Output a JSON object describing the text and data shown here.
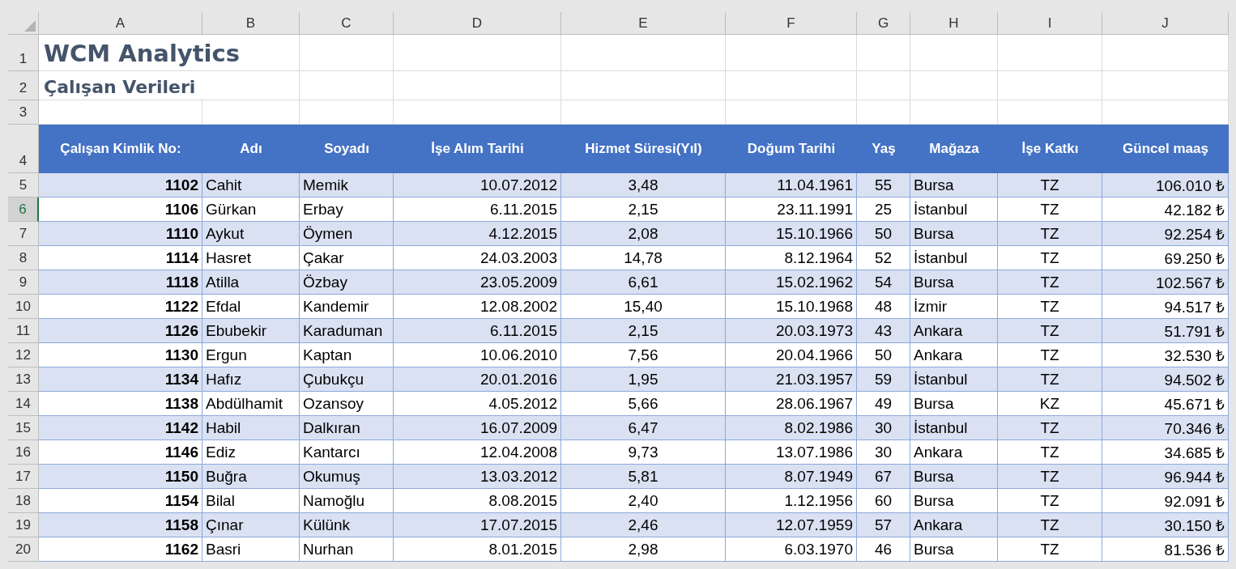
{
  "column_headers": [
    "A",
    "B",
    "C",
    "D",
    "E",
    "F",
    "G",
    "H",
    "I",
    "J"
  ],
  "row_headers": [
    {
      "label": "1",
      "selected": false
    },
    {
      "label": "2",
      "selected": false
    },
    {
      "label": "3",
      "selected": false
    },
    {
      "label": "4",
      "selected": false
    },
    {
      "label": "5",
      "selected": false
    },
    {
      "label": "6",
      "selected": true
    },
    {
      "label": "7",
      "selected": false
    },
    {
      "label": "8",
      "selected": false
    },
    {
      "label": "9",
      "selected": false
    },
    {
      "label": "10",
      "selected": false
    },
    {
      "label": "11",
      "selected": false
    },
    {
      "label": "12",
      "selected": false
    },
    {
      "label": "13",
      "selected": false
    },
    {
      "label": "14",
      "selected": false
    },
    {
      "label": "15",
      "selected": false
    },
    {
      "label": "16",
      "selected": false
    },
    {
      "label": "17",
      "selected": false
    },
    {
      "label": "18",
      "selected": false
    },
    {
      "label": "19",
      "selected": false
    },
    {
      "label": "20",
      "selected": false
    }
  ],
  "title": "WCM Analytics",
  "subtitle": "Çalışan Verileri",
  "table": {
    "columns": [
      "Çalışan Kimlik No:",
      "Adı",
      "Soyadı",
      "İşe Alım Tarihi",
      "Hizmet Süresi(Yıl)",
      "Doğum Tarihi",
      "Yaş",
      "Mağaza",
      "İşe Katkı",
      "Güncel maaş"
    ],
    "rows": [
      [
        "1102",
        "Cahit",
        "Memik",
        "10.07.2012",
        "3,48",
        "11.04.1961",
        "55",
        "Bursa",
        "TZ",
        "106.010 ₺"
      ],
      [
        "1106",
        "Gürkan",
        "Erbay",
        "6.11.2015",
        "2,15",
        "23.11.1991",
        "25",
        "İstanbul",
        "TZ",
        "42.182 ₺"
      ],
      [
        "1110",
        "Aykut",
        "Öymen",
        "4.12.2015",
        "2,08",
        "15.10.1966",
        "50",
        "Bursa",
        "TZ",
        "92.254 ₺"
      ],
      [
        "1114",
        "Hasret",
        "Çakar",
        "24.03.2003",
        "14,78",
        "8.12.1964",
        "52",
        "İstanbul",
        "TZ",
        "69.250 ₺"
      ],
      [
        "1118",
        "Atilla",
        "Özbay",
        "23.05.2009",
        "6,61",
        "15.02.1962",
        "54",
        "Bursa",
        "TZ",
        "102.567 ₺"
      ],
      [
        "1122",
        "Efdal",
        "Kandemir",
        "12.08.2002",
        "15,40",
        "15.10.1968",
        "48",
        "İzmir",
        "TZ",
        "94.517 ₺"
      ],
      [
        "1126",
        "Ebubekir",
        "Karaduman",
        "6.11.2015",
        "2,15",
        "20.03.1973",
        "43",
        "Ankara",
        "TZ",
        "51.791 ₺"
      ],
      [
        "1130",
        "Ergun",
        "Kaptan",
        "10.06.2010",
        "7,56",
        "20.04.1966",
        "50",
        "Ankara",
        "TZ",
        "32.530 ₺"
      ],
      [
        "1134",
        "Hafız",
        "Çubukçu",
        "20.01.2016",
        "1,95",
        "21.03.1957",
        "59",
        "İstanbul",
        "TZ",
        "94.502 ₺"
      ],
      [
        "1138",
        "Abdülhamit",
        "Ozansoy",
        "4.05.2012",
        "5,66",
        "28.06.1967",
        "49",
        "Bursa",
        "KZ",
        "45.671 ₺"
      ],
      [
        "1142",
        "Habil",
        "Dalkıran",
        "16.07.2009",
        "6,47",
        "8.02.1986",
        "30",
        "İstanbul",
        "TZ",
        "70.346 ₺"
      ],
      [
        "1146",
        "Ediz",
        "Kantarcı",
        "12.04.2008",
        "9,73",
        "13.07.1986",
        "30",
        "Ankara",
        "TZ",
        "34.685 ₺"
      ],
      [
        "1150",
        "Buğra",
        "Okumuş",
        "13.03.2012",
        "5,81",
        "8.07.1949",
        "67",
        "Bursa",
        "TZ",
        "96.944 ₺"
      ],
      [
        "1154",
        "Bilal",
        "Namoğlu",
        "8.08.2015",
        "2,40",
        "1.12.1956",
        "60",
        "Bursa",
        "TZ",
        "92.091 ₺"
      ],
      [
        "1158",
        "Çınar",
        "Külünk",
        "17.07.2015",
        "2,46",
        "12.07.1959",
        "57",
        "Ankara",
        "TZ",
        "30.150 ₺"
      ],
      [
        "1162",
        "Basri",
        "Nurhan",
        "8.01.2015",
        "2,98",
        "6.03.1970",
        "46",
        "Bursa",
        "TZ",
        "81.536 ₺"
      ]
    ]
  }
}
